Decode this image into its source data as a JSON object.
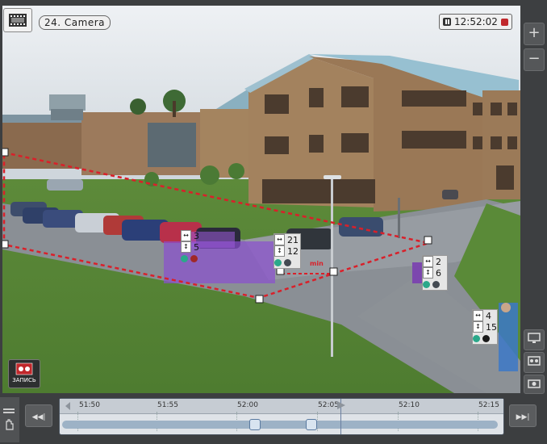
{
  "camera": {
    "label": "24. Camera"
  },
  "clock": {
    "time": "12:52:02"
  },
  "record": {
    "label": "ЗАПИСЬ"
  },
  "zone": {
    "marker": "min"
  },
  "tags": [
    {
      "w": "3",
      "h": "5"
    },
    {
      "w": "21",
      "h": "12"
    },
    {
      "w": "2",
      "h": "6"
    },
    {
      "w": "4",
      "h": "15"
    }
  ],
  "timeline": {
    "ticks": [
      "51:50",
      "51:55",
      "52:00",
      "52:05",
      "52:10",
      "52:15"
    ]
  },
  "icons": {
    "zoom_in": "+",
    "zoom_out": "−",
    "rewind": "◀◀|",
    "forward": "▶▶|"
  },
  "colors": {
    "zone_line": "#d9202a",
    "selection": "#8a4fd0"
  }
}
